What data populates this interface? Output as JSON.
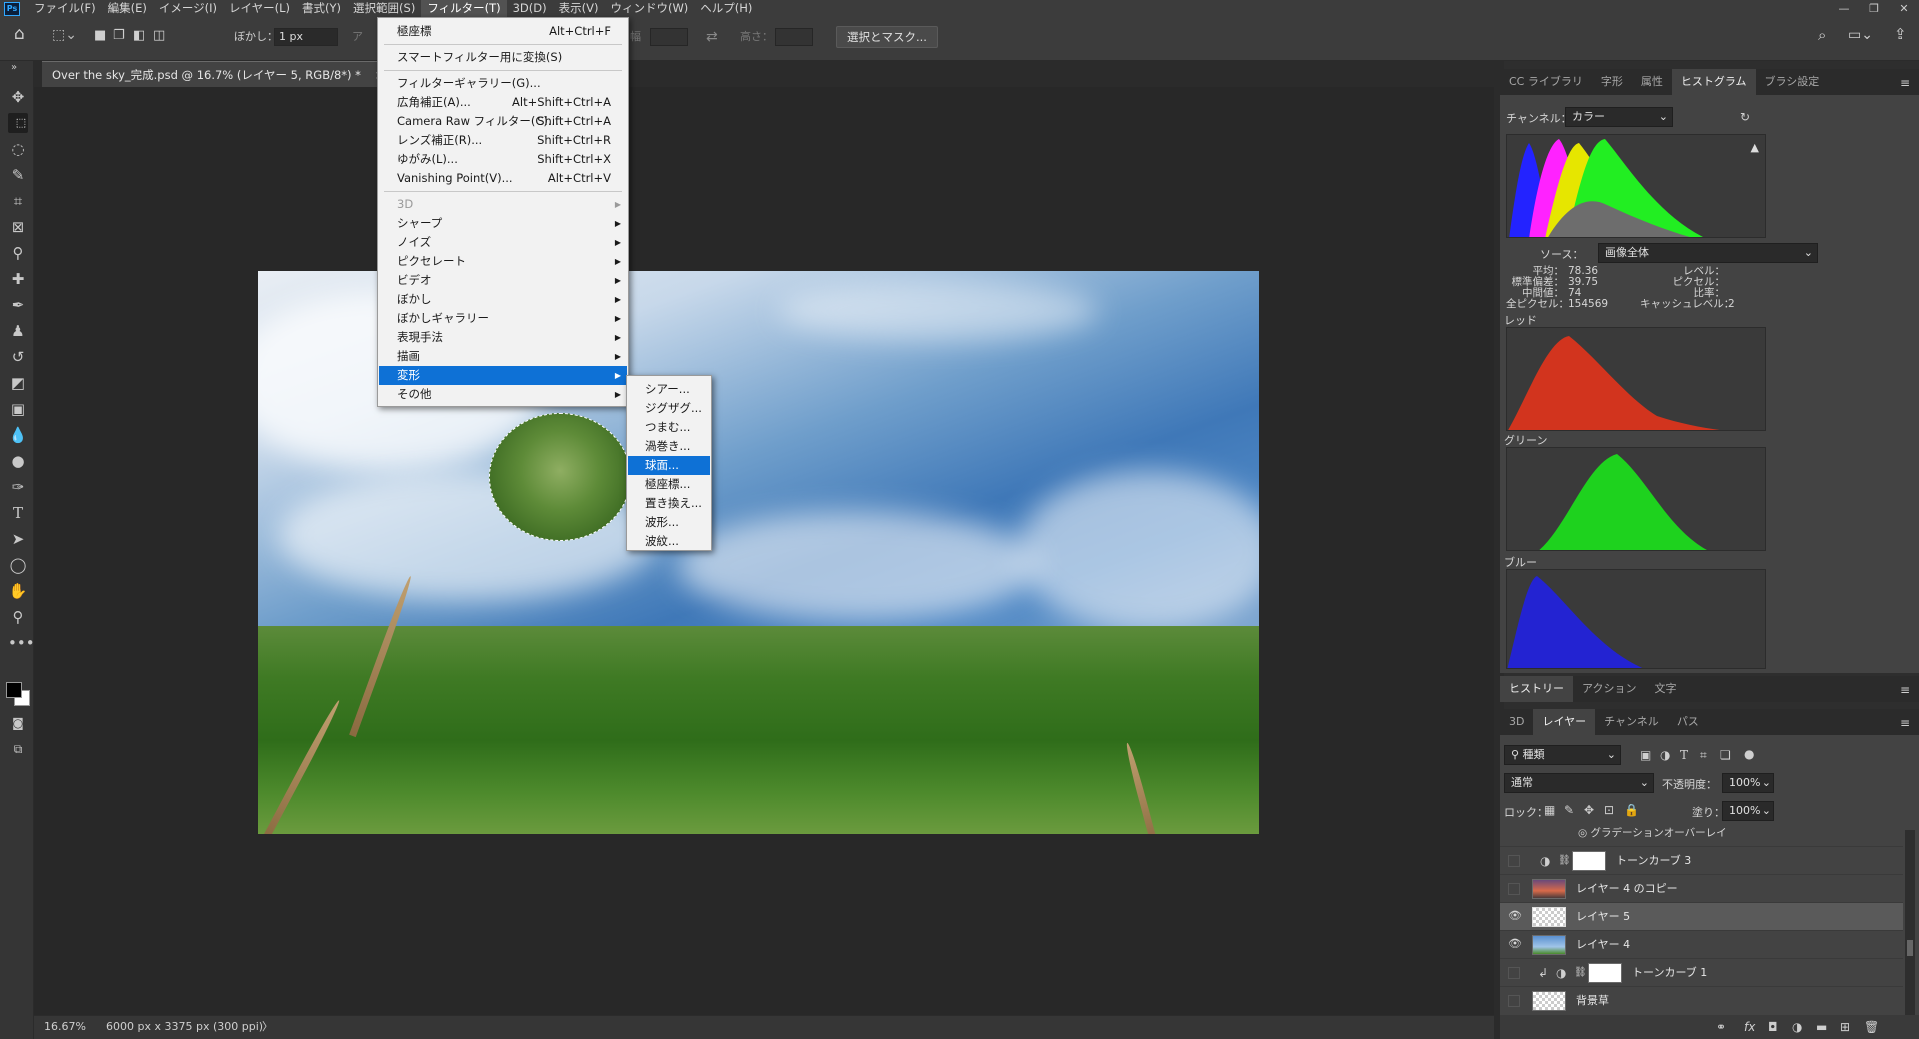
{
  "app": {
    "logo": "Ps"
  },
  "menubar": {
    "items": [
      "ファイル(F)",
      "編集(E)",
      "イメージ(I)",
      "レイヤー(L)",
      "書式(Y)",
      "選択範囲(S)",
      "フィルター(T)",
      "3D(D)",
      "表示(V)",
      "ウィンドウ(W)",
      "ヘルプ(H)"
    ],
    "active_index": 6
  },
  "window_controls": {
    "minimize": "—",
    "restore": "❐",
    "close": "✕"
  },
  "options_bar": {
    "feather_label": "ぼかし：",
    "feather_value": "1 px",
    "antialias_label": "ア",
    "width_label": "幅",
    "height_label": "高さ：",
    "select_mask_button": "選択とマスク..."
  },
  "document_tab": {
    "title": "Over the sky_完成.psd @ 16.7% (レイヤー 5, RGB/8*) *",
    "close": "×"
  },
  "status_bar": {
    "zoom": "16.67%",
    "doc_info": "6000 px x 3375 px (300 ppi)",
    "arrow": "〉"
  },
  "filter_menu": {
    "items": [
      {
        "label": "極座標",
        "shortcut": "Alt+Ctrl+F"
      },
      {
        "sep": true
      },
      {
        "label": "スマートフィルター用に変換(S)"
      },
      {
        "sep": true
      },
      {
        "label": "フィルターギャラリー(G)..."
      },
      {
        "label": "広角補正(A)...",
        "shortcut": "Alt+Shift+Ctrl+A"
      },
      {
        "label": "Camera Raw フィルター(C)...",
        "shortcut": "Shift+Ctrl+A"
      },
      {
        "label": "レンズ補正(R)...",
        "shortcut": "Shift+Ctrl+R"
      },
      {
        "label": "ゆがみ(L)...",
        "shortcut": "Shift+Ctrl+X"
      },
      {
        "label": "Vanishing Point(V)...",
        "shortcut": "Alt+Ctrl+V"
      },
      {
        "sep": true
      },
      {
        "label": "3D",
        "submenu": true,
        "disabled": true
      },
      {
        "label": "シャープ",
        "submenu": true
      },
      {
        "label": "ノイズ",
        "submenu": true
      },
      {
        "label": "ピクセレート",
        "submenu": true
      },
      {
        "label": "ビデオ",
        "submenu": true
      },
      {
        "label": "ぼかし",
        "submenu": true
      },
      {
        "label": "ぼかしギャラリー",
        "submenu": true
      },
      {
        "label": "表現手法",
        "submenu": true
      },
      {
        "label": "描画",
        "submenu": true
      },
      {
        "label": "変形",
        "submenu": true,
        "highlighted": true
      },
      {
        "label": "その他",
        "submenu": true
      }
    ]
  },
  "distort_submenu": {
    "items": [
      "シアー...",
      "ジグザグ...",
      "つまむ...",
      "渦巻き...",
      "球面...",
      "極座標...",
      "置き換え...",
      "波形...",
      "波紋..."
    ],
    "highlighted_index": 4
  },
  "right_panel": {
    "top_tabs": [
      "CC ライブラリ",
      "字形",
      "属性",
      "ヒストグラム",
      "ブラシ設定"
    ],
    "top_active": 3,
    "histogram": {
      "channel_label": "チャンネル：",
      "channel_value": "カラー",
      "source_label": "ソース：",
      "source_value": "画像全体",
      "stats_left_labels": [
        "平均：",
        "標準偏差：",
        "中間値：",
        "全ピクセル："
      ],
      "stats_left_values": [
        "78.36",
        "39.75",
        "74",
        "154569"
      ],
      "stats_right_labels": [
        "レベル：",
        "ピクセル：",
        "比率：",
        "キャッシュレベル："
      ],
      "stats_right_values": [
        "",
        "",
        "",
        "2"
      ],
      "red_label": "レッド",
      "green_label": "グリーン",
      "blue_label": "ブルー"
    },
    "mid_tabs": [
      "ヒストリー",
      "アクション",
      "文字"
    ],
    "mid_active": 0,
    "layer_tabs": [
      "3D",
      "レイヤー",
      "チャンネル",
      "パス"
    ],
    "layer_active": 1,
    "filter_kind": "種類",
    "blend_mode": "通常",
    "opacity_label": "不透明度：",
    "opacity_value": "100%",
    "lock_label": "ロック：",
    "fill_label": "塗り：",
    "fill_value": "100%",
    "gradient_overlay": "グラデーションオーバーレイ",
    "layers": [
      {
        "name": "トーンカーブ 3",
        "visible": false,
        "kind": "adjust"
      },
      {
        "name": "レイヤー 4 のコピー",
        "visible": false,
        "kind": "sunset"
      },
      {
        "name": "レイヤー 5",
        "visible": true,
        "kind": "transparent",
        "active": true
      },
      {
        "name": "レイヤー 4",
        "visible": true,
        "kind": "sky"
      },
      {
        "name": "トーンカーブ 1",
        "visible": false,
        "kind": "adjust",
        "clipped": true
      },
      {
        "name": "背景草",
        "visible": false,
        "kind": "transparent"
      }
    ]
  },
  "colors": {
    "accent": "#0e71d6",
    "panel": "#434343",
    "canvas": "#282828"
  }
}
